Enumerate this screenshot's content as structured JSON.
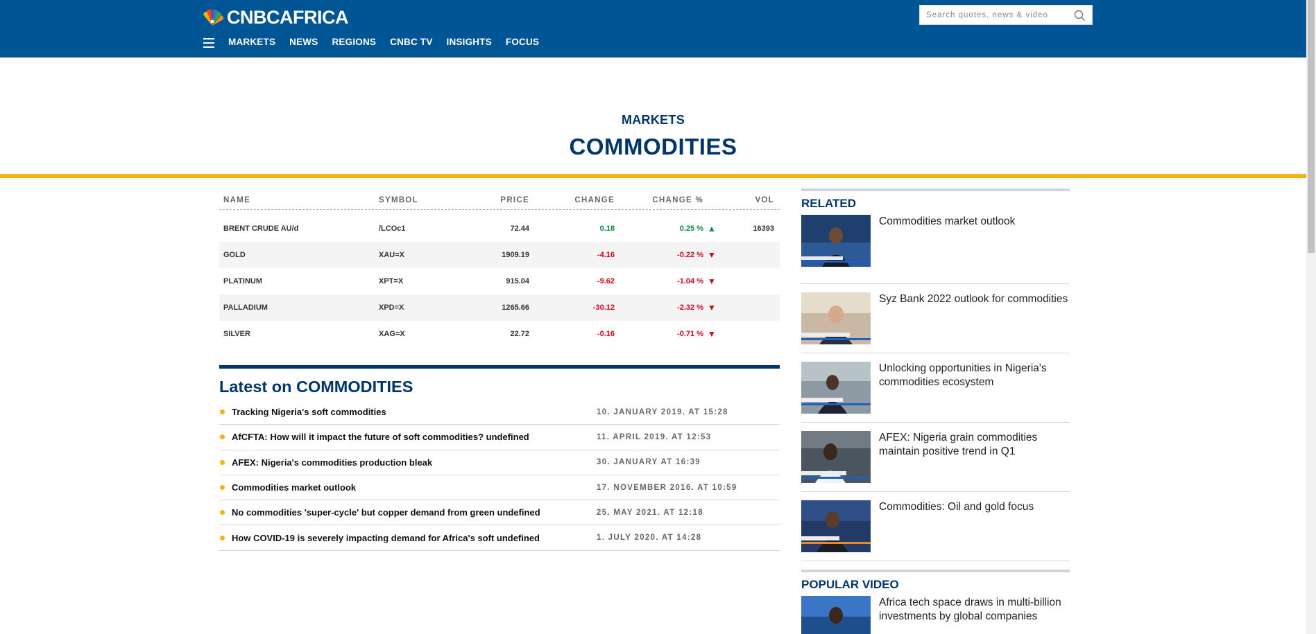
{
  "header": {
    "logo_text": "CNBCAFRICA",
    "search_placeholder": "Search quotes, news & video",
    "nav": [
      "MARKETS",
      "NEWS",
      "REGIONS",
      "CNBC TV",
      "INSIGHTS",
      "FOCUS"
    ]
  },
  "hero": {
    "section": "MARKETS",
    "title": "COMMODITIES"
  },
  "quotes": {
    "columns": {
      "name": "NAME",
      "symbol": "SYMBOL",
      "price": "PRICE",
      "change": "CHANGE",
      "change_pct": "CHANGE %",
      "vol": "VOL"
    },
    "rows": [
      {
        "name": "BRENT CRUDE AU/d",
        "symbol": "/LCOc1",
        "price": "72.44",
        "change": "0.18",
        "change_pct": "0.25 %",
        "direction": "up",
        "vol": "16393"
      },
      {
        "name": "GOLD",
        "symbol": "XAU=X",
        "price": "1909.19",
        "change": "-4.16",
        "change_pct": "-0.22 %",
        "direction": "down",
        "vol": ""
      },
      {
        "name": "PLATINUM",
        "symbol": "XPT=X",
        "price": "915.04",
        "change": "-9.62",
        "change_pct": "-1.04 %",
        "direction": "down",
        "vol": ""
      },
      {
        "name": "PALLADIUM",
        "symbol": "XPD=X",
        "price": "1265.66",
        "change": "-30.12",
        "change_pct": "-2.32 %",
        "direction": "down",
        "vol": ""
      },
      {
        "name": "SILVER",
        "symbol": "XAG=X",
        "price": "22.72",
        "change": "-0.16",
        "change_pct": "-0.71 %",
        "direction": "down",
        "vol": ""
      }
    ]
  },
  "latest": {
    "heading": "Latest on COMMODITIES",
    "items": [
      {
        "title": "Tracking Nigeria's soft commodities",
        "date": "10. JANUARY 2019. AT 15:28"
      },
      {
        "title": "AfCFTA: How will it impact the future of soft commodities? undefined",
        "date": "11. APRIL 2019. AT 12:53"
      },
      {
        "title": "AFEX: Nigeria's commodities production bleak",
        "date": "30. JANUARY AT 16:39"
      },
      {
        "title": "Commodities market outlook",
        "date": "17. NOVEMBER 2016. AT 10:59"
      },
      {
        "title": "No commodities 'super-cycle' but copper demand from green undefined",
        "date": "25. MAY 2021. AT 12:18"
      },
      {
        "title": "How COVID-19 is severely impacting demand for Africa's soft undefined",
        "date": "1. JULY 2020. AT 14:28"
      }
    ]
  },
  "related": {
    "heading": "RELATED",
    "items": [
      {
        "title": "Commodities market outlook"
      },
      {
        "title": "Syz Bank 2022 outlook for commodities"
      },
      {
        "title": "Unlocking opportunities in Nigeria's commodities ecosystem"
      },
      {
        "title": "AFEX: Nigeria grain commodities maintain positive trend in Q1"
      },
      {
        "title": "Commodities: Oil and gold focus"
      }
    ]
  },
  "popular": {
    "heading": "POPULAR VIDEO",
    "items": [
      {
        "title": "Africa tech space draws in multi-billion investments by global companies"
      }
    ]
  },
  "colors": {
    "brand_blue": "#005594",
    "navy": "#00356b",
    "accent_yellow": "#f2b311",
    "positive": "#0a8a3c",
    "negative": "#d0021b"
  }
}
